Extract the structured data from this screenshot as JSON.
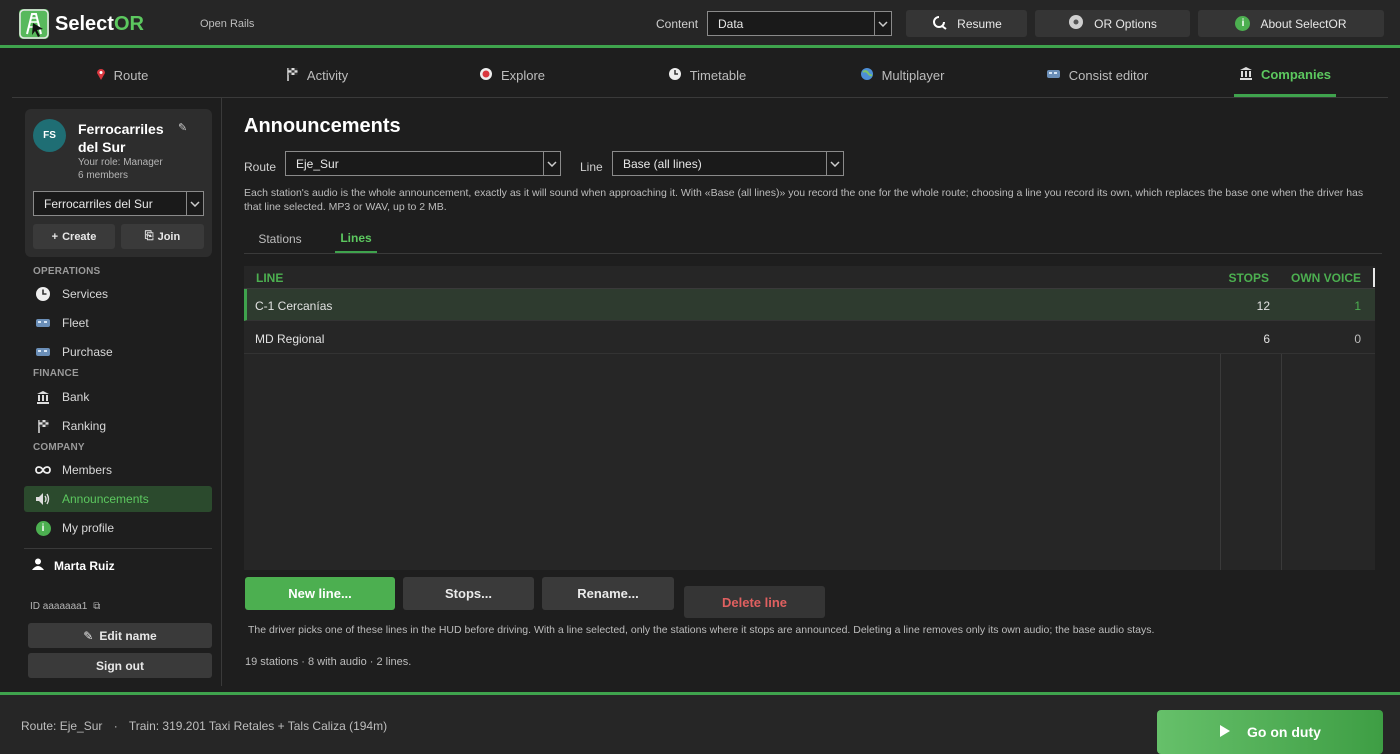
{
  "app": {
    "name_main": "Select",
    "name_accent": "OR",
    "subtitle": "Open Rails"
  },
  "header": {
    "content_label": "Content",
    "content_value": "Data",
    "resume_label": "Resume",
    "options_label": "OR Options",
    "about_label": "About SelectOR"
  },
  "tabs": [
    {
      "label": "Route",
      "icon": "pin-icon"
    },
    {
      "label": "Activity",
      "icon": "flag-icon"
    },
    {
      "label": "Explore",
      "icon": "target-icon"
    },
    {
      "label": "Timetable",
      "icon": "clock-icon"
    },
    {
      "label": "Multiplayer",
      "icon": "globe-icon"
    },
    {
      "label": "Consist editor",
      "icon": "train-icon"
    },
    {
      "label": "Companies",
      "icon": "bank-icon",
      "active": true
    }
  ],
  "sidebar": {
    "company": {
      "initials": "FS",
      "name": "Ferrocarriles del Sur",
      "role": "Your role: Manager",
      "members": "6 members",
      "selector_value": "Ferrocarriles del Sur",
      "create_label": "Create",
      "join_label": "Join"
    },
    "sections": {
      "operations": "OPERATIONS",
      "finance": "FINANCE",
      "company": "COMPANY"
    },
    "items": {
      "services": "Services",
      "fleet": "Fleet",
      "purchase": "Purchase",
      "bank": "Bank",
      "ranking": "Ranking",
      "members": "Members",
      "announcements": "Announcements",
      "profile": "My profile"
    },
    "user": {
      "name": "Marta Ruiz",
      "id": "ID aaaaaaa1",
      "edit_label": "Edit name",
      "signout_label": "Sign out"
    }
  },
  "main": {
    "title": "Announcements",
    "route_label": "Route",
    "route_value": "Eje_Sur",
    "line_label": "Line",
    "line_value": "Base (all lines)",
    "help_text": "Each station's audio is the whole announcement, exactly as it will sound when approaching it. With «Base (all lines)» you record the one for the whole route; choosing a line you record its own, which replaces the base one when the driver has that line selected. MP3 or WAV, up to 2 MB.",
    "subtabs": {
      "stations": "Stations",
      "lines": "Lines"
    },
    "table": {
      "col_line": "LINE",
      "col_stops": "STOPS",
      "col_voice": "OWN VOICE",
      "rows": [
        {
          "line": "C-1 Cercanías",
          "stops": "12",
          "voice": "1"
        },
        {
          "line": "MD Regional",
          "stops": "6",
          "voice": "0"
        }
      ]
    },
    "buttons": {
      "new_line": "New line...",
      "stops": "Stops...",
      "rename": "Rename...",
      "delete": "Delete line"
    },
    "note": "The driver picks one of these lines in the HUD before driving. With a line selected, only the stations where it stops are announced. Deleting a line removes only its own audio; the base audio stays.",
    "summary": "19 stations · 8 with audio · 2 lines."
  },
  "footer": {
    "route_status": "Route: Eje_Sur",
    "separator": "·",
    "train_status": "Train: 319.201 Taxi Retales + Tals Caliza (194m)",
    "go_label": "Go on duty"
  },
  "colors": {
    "accent": "#3fa34d",
    "accent_text": "#5cc85f",
    "danger": "#e06060",
    "background": "#1e1e1e"
  }
}
